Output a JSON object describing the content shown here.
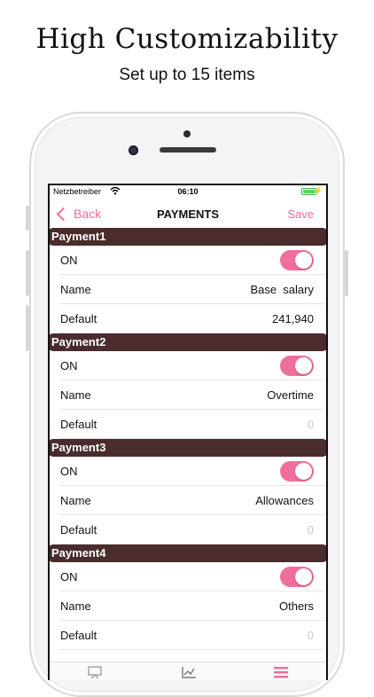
{
  "promo": {
    "headline": "High Customizability",
    "subline": "Set up to 15 items"
  },
  "status_bar": {
    "carrier": "Netzbetreiber",
    "time": "06:10"
  },
  "nav": {
    "back_label": "Back",
    "title": "PAYMENTS",
    "save_label": "Save"
  },
  "row_labels": {
    "on": "ON",
    "name": "Name",
    "default": "Default"
  },
  "sections": [
    {
      "title": "Payment1",
      "name": "Base  salary",
      "default": "241,940",
      "default_is_placeholder": false
    },
    {
      "title": "Payment2",
      "name": "Overtime",
      "default": "0",
      "default_is_placeholder": true
    },
    {
      "title": "Payment3",
      "name": "Allowances",
      "default": "0",
      "default_is_placeholder": true
    },
    {
      "title": "Payment4",
      "name": "Others",
      "default": "0",
      "default_is_placeholder": true
    }
  ],
  "icons": {
    "wifi": "wifi-icon",
    "battery": "battery-icon",
    "tab1": "board-icon",
    "tab2": "chart-icon",
    "tab3": "menu-icon"
  },
  "colors": {
    "accent": "#f06e9c",
    "section_header": "#4a2c2c",
    "placeholder": "#c8c8c8"
  }
}
